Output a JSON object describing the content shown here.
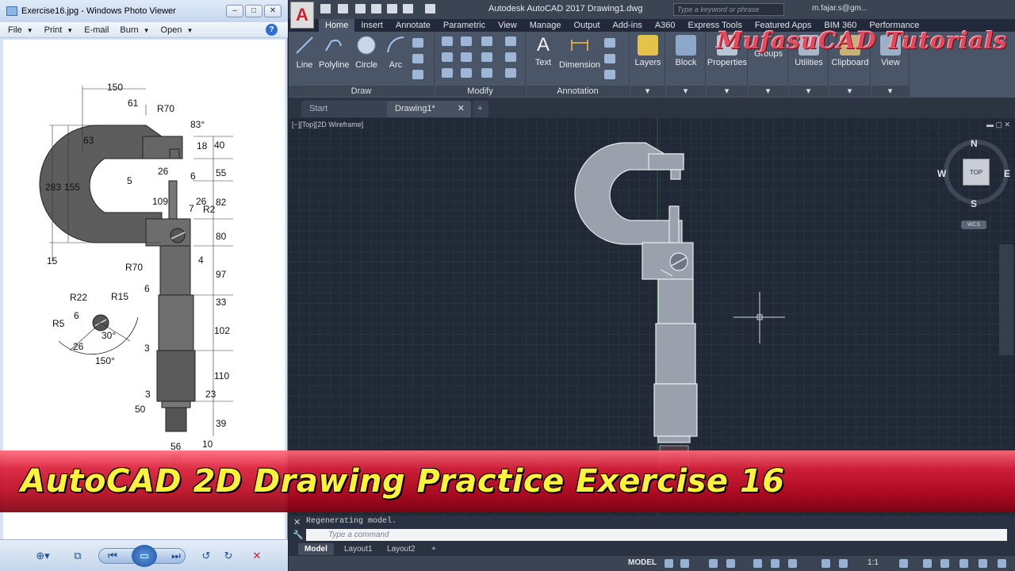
{
  "photo_viewer": {
    "title": "Exercise16.jpg - Windows Photo Viewer",
    "menu": [
      {
        "label": "File",
        "has_caret": true
      },
      {
        "label": "Print",
        "has_caret": true
      },
      {
        "label": "E-mail",
        "has_caret": false
      },
      {
        "label": "Burn",
        "has_caret": true
      },
      {
        "label": "Open",
        "has_caret": true
      }
    ],
    "help_label": "?",
    "drawing_dims": {
      "d150": "150",
      "d61": "61",
      "r70a": "R70",
      "a83": "83°",
      "d63": "63",
      "d18": "18",
      "d40": "40",
      "d283": "283",
      "d155": "155",
      "d5": "5",
      "d26a": "26",
      "d6a": "6",
      "d55": "55",
      "d109": "109",
      "d26b": "26",
      "d7": "7",
      "r2": "R2",
      "d82": "82",
      "d80": "80",
      "d15": "15",
      "r70b": "R70",
      "d4": "4",
      "d97": "97",
      "d6b": "6",
      "d33": "33",
      "r22": "R22",
      "r15": "R15",
      "r5": "R5",
      "d6c": "6",
      "a30": "30°",
      "d26c": "26",
      "d102": "102",
      "a150": "150°",
      "d3a": "3",
      "d110": "110",
      "d3b": "3",
      "d23": "23",
      "d50": "50",
      "d39": "39",
      "d56": "56",
      "d10": "10",
      "d64": "64"
    }
  },
  "autocad": {
    "logo": "A",
    "title": "Autodesk AutoCAD 2017    Drawing1.dwg",
    "search_placeholder": "Type a keyword or phrase",
    "user": "m.fajar.s@gm...",
    "ribbon_tabs": [
      "Home",
      "Insert",
      "Annotate",
      "Parametric",
      "View",
      "Manage",
      "Output",
      "Add-ins",
      "A360",
      "Express Tools",
      "Featured Apps",
      "BIM 360",
      "Performance"
    ],
    "draw_tools": [
      "Line",
      "Polyline",
      "Circle",
      "Arc"
    ],
    "annotation_tools": [
      "Text",
      "Dimension"
    ],
    "other_tools": [
      "Layers",
      "Block",
      "Properties",
      "Groups",
      "Utilities",
      "Clipboard",
      "View"
    ],
    "panel_labels": {
      "draw": "Draw",
      "modify": "Modify",
      "annotation": "Annotation"
    },
    "doc_tabs": [
      "Start",
      "Drawing1*"
    ],
    "viewport_label": "[−][Top][2D Wireframe]",
    "viewcube": {
      "face": "TOP",
      "n": "N",
      "s": "S",
      "e": "E",
      "w": "W",
      "wcs": "WCS"
    },
    "command_history": "Regenerating model.",
    "command_placeholder": "Type a command",
    "layout_tabs": [
      "Model",
      "Layout1",
      "Layout2"
    ],
    "status_model": "MODEL",
    "scale": "1:1"
  },
  "branding": "MufasuCAD Tutorials",
  "banner": "AutoCAD 2D Drawing Practice Exercise 16"
}
